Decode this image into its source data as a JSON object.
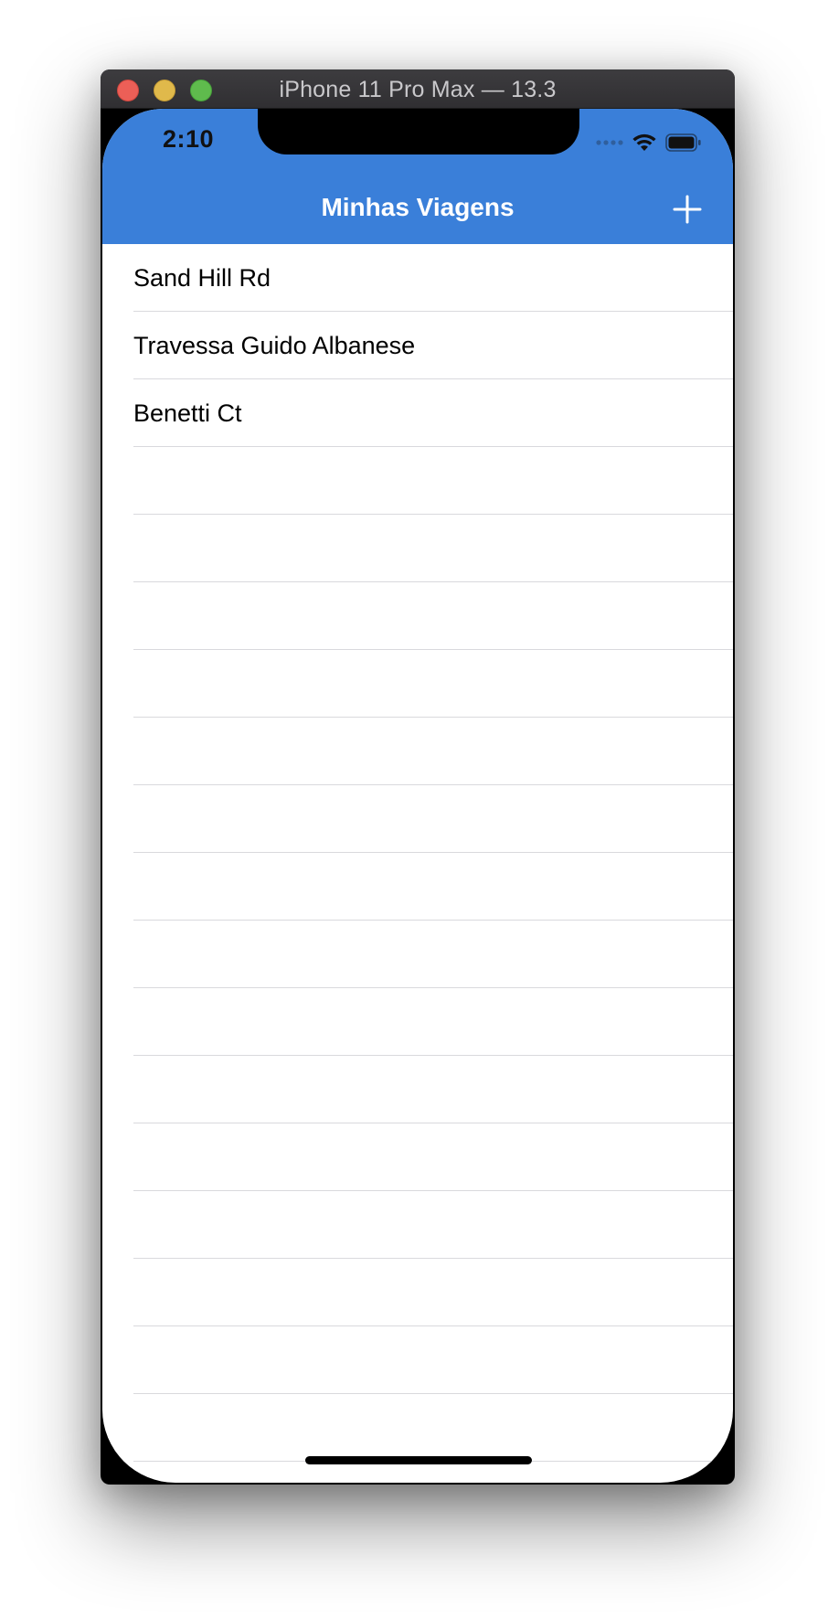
{
  "window": {
    "title": "iPhone 11 Pro Max — 13.3"
  },
  "status_bar": {
    "time": "2:10",
    "icons": [
      "cellular-dots-icon",
      "wifi-icon",
      "battery-icon"
    ]
  },
  "navbar": {
    "title": "Minhas Viagens",
    "add_icon": "plus-icon",
    "color": "#3a7fd9"
  },
  "trips": [
    {
      "label": "Sand Hill Rd"
    },
    {
      "label": "Travessa Guido Albanese"
    },
    {
      "label": "Benetti Ct"
    },
    {
      "label": ""
    },
    {
      "label": ""
    },
    {
      "label": ""
    },
    {
      "label": ""
    },
    {
      "label": ""
    },
    {
      "label": ""
    },
    {
      "label": ""
    },
    {
      "label": ""
    },
    {
      "label": ""
    },
    {
      "label": ""
    },
    {
      "label": ""
    },
    {
      "label": ""
    },
    {
      "label": ""
    },
    {
      "label": ""
    },
    {
      "label": ""
    },
    {
      "label": ""
    }
  ]
}
